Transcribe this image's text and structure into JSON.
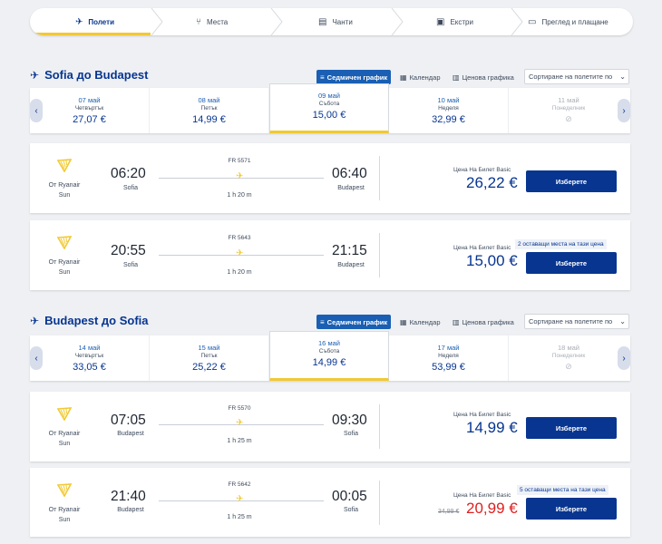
{
  "stepper": [
    {
      "label": "Полети",
      "icon": "plane-icon"
    },
    {
      "label": "Места",
      "icon": "seat-icon"
    },
    {
      "label": "Чанти",
      "icon": "bag-icon"
    },
    {
      "label": "Екстри",
      "icon": "bus-icon"
    },
    {
      "label": "Преглед и плащане",
      "icon": "card-icon"
    }
  ],
  "views": {
    "weekly": "Седмичен график",
    "calendar": "Календар",
    "price": "Ценова графика"
  },
  "sort_label": "Сортиране на полетите по",
  "sections": [
    {
      "title": "Sofia до Budapest",
      "days": [
        {
          "date": "07 май",
          "weekday": "Четвъртък",
          "price": "27,07 €"
        },
        {
          "date": "08 май",
          "weekday": "Петък",
          "price": "14,99 €"
        },
        {
          "date": "09 май",
          "weekday": "Събота",
          "price": "15,00 €"
        },
        {
          "date": "10 май",
          "weekday": "Неделя",
          "price": "32,99 €"
        },
        {
          "date": "11 май",
          "weekday": "Понеделник",
          "price": "⊘"
        }
      ],
      "flights": [
        {
          "operator": "От Ryanair\nSun",
          "dep": "06:20",
          "dep_city": "Sofia",
          "arr": "06:40",
          "arr_city": "Budapest",
          "number": "FR 5571",
          "duration": "1 h 20 m",
          "price_label": "Цена На Билет Basic",
          "price": "26,22 €",
          "old_price": "",
          "seats": "",
          "button": "Изберете"
        },
        {
          "operator": "От Ryanair\nSun",
          "dep": "20:55",
          "dep_city": "Sofia",
          "arr": "21:15",
          "arr_city": "Budapest",
          "number": "FR 5643",
          "duration": "1 h 20 m",
          "price_label": "Цена На Билет Basic",
          "price": "15,00 €",
          "old_price": "",
          "seats": "2 оставащи места на тази цена",
          "button": "Изберете"
        }
      ]
    },
    {
      "title": "Budapest до Sofia",
      "days": [
        {
          "date": "14 май",
          "weekday": "Четвъртък",
          "price": "33,05 €"
        },
        {
          "date": "15 май",
          "weekday": "Петък",
          "price": "25,22 €"
        },
        {
          "date": "16 май",
          "weekday": "Събота",
          "price": "14,99 €"
        },
        {
          "date": "17 май",
          "weekday": "Неделя",
          "price": "53,99 €"
        },
        {
          "date": "18 май",
          "weekday": "Понеделник",
          "price": "⊘"
        }
      ],
      "flights": [
        {
          "operator": "От Ryanair\nSun",
          "dep": "07:05",
          "dep_city": "Budapest",
          "arr": "09:30",
          "arr_city": "Sofia",
          "number": "FR 5570",
          "duration": "1 h 25 m",
          "price_label": "Цена На Билет Basic",
          "price": "14,99 €",
          "old_price": "",
          "seats": "",
          "button": "Изберете"
        },
        {
          "operator": "От Ryanair\nSun",
          "dep": "21:40",
          "dep_city": "Budapest",
          "arr": "00:05",
          "arr_city": "Sofia",
          "number": "FR 5642",
          "duration": "1 h 25 m",
          "price_label": "Цена На Билет Basic",
          "price": "20,99 €",
          "old_price": "34,99 €",
          "seats": "5 оставащи места на тази цена",
          "button": "Изберете"
        }
      ]
    }
  ],
  "colors": {
    "brand": "#073590",
    "accent": "#f1c933",
    "sale": "#e02020"
  }
}
